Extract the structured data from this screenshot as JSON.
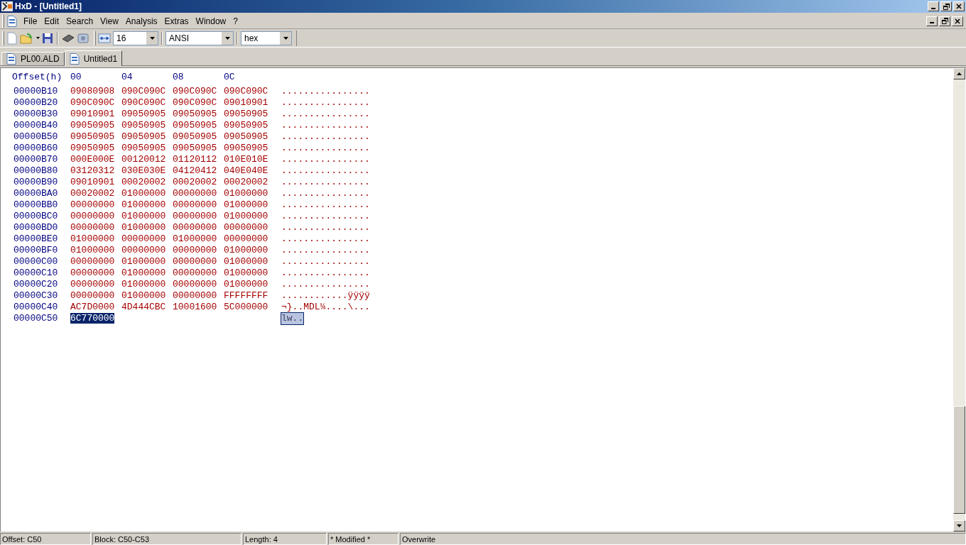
{
  "window": {
    "title": "HxD - [Untitled1]"
  },
  "menu": [
    "File",
    "Edit",
    "Search",
    "View",
    "Analysis",
    "Extras",
    "Window",
    "?"
  ],
  "toolbar": {
    "bytes_per_row": "16",
    "charset": "ANSI",
    "base": "hex"
  },
  "tabs": [
    {
      "label": "PL00.ALD",
      "selected": false
    },
    {
      "label": "Untitled1",
      "selected": true
    }
  ],
  "editor": {
    "offset_header": "Offset(h)",
    "column_headers": [
      "00",
      "04",
      "08",
      "0C"
    ],
    "rows": [
      {
        "offset": "00000B10",
        "groups": [
          {
            "hex": "09080908",
            "selected": false
          },
          {
            "hex": "090C090C",
            "selected": false
          },
          {
            "hex": "090C090C",
            "selected": false
          },
          {
            "hex": "090C090C",
            "selected": false
          }
        ],
        "text": "................",
        "text_selected": false
      },
      {
        "offset": "00000B20",
        "groups": [
          {
            "hex": "090C090C",
            "selected": false
          },
          {
            "hex": "090C090C",
            "selected": false
          },
          {
            "hex": "090C090C",
            "selected": false
          },
          {
            "hex": "09010901",
            "selected": false
          }
        ],
        "text": "................",
        "text_selected": false
      },
      {
        "offset": "00000B30",
        "groups": [
          {
            "hex": "09010901",
            "selected": false
          },
          {
            "hex": "09050905",
            "selected": false
          },
          {
            "hex": "09050905",
            "selected": false
          },
          {
            "hex": "09050905",
            "selected": false
          }
        ],
        "text": "................",
        "text_selected": false
      },
      {
        "offset": "00000B40",
        "groups": [
          {
            "hex": "09050905",
            "selected": false
          },
          {
            "hex": "09050905",
            "selected": false
          },
          {
            "hex": "09050905",
            "selected": false
          },
          {
            "hex": "09050905",
            "selected": false
          }
        ],
        "text": "................",
        "text_selected": false
      },
      {
        "offset": "00000B50",
        "groups": [
          {
            "hex": "09050905",
            "selected": false
          },
          {
            "hex": "09050905",
            "selected": false
          },
          {
            "hex": "09050905",
            "selected": false
          },
          {
            "hex": "09050905",
            "selected": false
          }
        ],
        "text": "................",
        "text_selected": false
      },
      {
        "offset": "00000B60",
        "groups": [
          {
            "hex": "09050905",
            "selected": false
          },
          {
            "hex": "09050905",
            "selected": false
          },
          {
            "hex": "09050905",
            "selected": false
          },
          {
            "hex": "09050905",
            "selected": false
          }
        ],
        "text": "................",
        "text_selected": false
      },
      {
        "offset": "00000B70",
        "groups": [
          {
            "hex": "000E000E",
            "selected": false
          },
          {
            "hex": "00120012",
            "selected": false
          },
          {
            "hex": "01120112",
            "selected": false
          },
          {
            "hex": "010E010E",
            "selected": false
          }
        ],
        "text": "................",
        "text_selected": false
      },
      {
        "offset": "00000B80",
        "groups": [
          {
            "hex": "03120312",
            "selected": false
          },
          {
            "hex": "030E030E",
            "selected": false
          },
          {
            "hex": "04120412",
            "selected": false
          },
          {
            "hex": "040E040E",
            "selected": false
          }
        ],
        "text": "................",
        "text_selected": false
      },
      {
        "offset": "00000B90",
        "groups": [
          {
            "hex": "09010901",
            "selected": false
          },
          {
            "hex": "00020002",
            "selected": false
          },
          {
            "hex": "00020002",
            "selected": false
          },
          {
            "hex": "00020002",
            "selected": false
          }
        ],
        "text": "................",
        "text_selected": false
      },
      {
        "offset": "00000BA0",
        "groups": [
          {
            "hex": "00020002",
            "selected": false
          },
          {
            "hex": "01000000",
            "selected": false
          },
          {
            "hex": "00000000",
            "selected": false
          },
          {
            "hex": "01000000",
            "selected": false
          }
        ],
        "text": "................",
        "text_selected": false
      },
      {
        "offset": "00000BB0",
        "groups": [
          {
            "hex": "00000000",
            "selected": false
          },
          {
            "hex": "01000000",
            "selected": false
          },
          {
            "hex": "00000000",
            "selected": false
          },
          {
            "hex": "01000000",
            "selected": false
          }
        ],
        "text": "................",
        "text_selected": false
      },
      {
        "offset": "00000BC0",
        "groups": [
          {
            "hex": "00000000",
            "selected": false
          },
          {
            "hex": "01000000",
            "selected": false
          },
          {
            "hex": "00000000",
            "selected": false
          },
          {
            "hex": "01000000",
            "selected": false
          }
        ],
        "text": "................",
        "text_selected": false
      },
      {
        "offset": "00000BD0",
        "groups": [
          {
            "hex": "00000000",
            "selected": false
          },
          {
            "hex": "01000000",
            "selected": false
          },
          {
            "hex": "00000000",
            "selected": false
          },
          {
            "hex": "00000000",
            "selected": false
          }
        ],
        "text": "................",
        "text_selected": false
      },
      {
        "offset": "00000BE0",
        "groups": [
          {
            "hex": "01000000",
            "selected": false
          },
          {
            "hex": "00000000",
            "selected": false
          },
          {
            "hex": "01000000",
            "selected": false
          },
          {
            "hex": "00000000",
            "selected": false
          }
        ],
        "text": "................",
        "text_selected": false
      },
      {
        "offset": "00000BF0",
        "groups": [
          {
            "hex": "01000000",
            "selected": false
          },
          {
            "hex": "00000000",
            "selected": false
          },
          {
            "hex": "00000000",
            "selected": false
          },
          {
            "hex": "01000000",
            "selected": false
          }
        ],
        "text": "................",
        "text_selected": false
      },
      {
        "offset": "00000C00",
        "groups": [
          {
            "hex": "00000000",
            "selected": false
          },
          {
            "hex": "01000000",
            "selected": false
          },
          {
            "hex": "00000000",
            "selected": false
          },
          {
            "hex": "01000000",
            "selected": false
          }
        ],
        "text": "................",
        "text_selected": false
      },
      {
        "offset": "00000C10",
        "groups": [
          {
            "hex": "00000000",
            "selected": false
          },
          {
            "hex": "01000000",
            "selected": false
          },
          {
            "hex": "00000000",
            "selected": false
          },
          {
            "hex": "01000000",
            "selected": false
          }
        ],
        "text": "................",
        "text_selected": false
      },
      {
        "offset": "00000C20",
        "groups": [
          {
            "hex": "00000000",
            "selected": false
          },
          {
            "hex": "01000000",
            "selected": false
          },
          {
            "hex": "00000000",
            "selected": false
          },
          {
            "hex": "01000000",
            "selected": false
          }
        ],
        "text": "................",
        "text_selected": false
      },
      {
        "offset": "00000C30",
        "groups": [
          {
            "hex": "00000000",
            "selected": false
          },
          {
            "hex": "01000000",
            "selected": false
          },
          {
            "hex": "00000000",
            "selected": false
          },
          {
            "hex": "FFFFFFFF",
            "selected": false
          }
        ],
        "text": "............ÿÿÿÿ",
        "text_selected": false
      },
      {
        "offset": "00000C40",
        "groups": [
          {
            "hex": "AC7D0000",
            "selected": false
          },
          {
            "hex": "4D444CBC",
            "selected": false
          },
          {
            "hex": "10001600",
            "selected": false
          },
          {
            "hex": "5C000000",
            "selected": false
          }
        ],
        "text": "¬}..MDL¼....\\...",
        "text_selected": false
      },
      {
        "offset": "00000C50",
        "groups": [
          {
            "hex": "6C770000",
            "selected": true
          }
        ],
        "text": "lw..",
        "text_selected": true
      }
    ]
  },
  "status_bar": [
    "Offset: C50",
    "Block: C50-C53",
    "Length: 4",
    "* Modified *",
    "Overwrite"
  ]
}
